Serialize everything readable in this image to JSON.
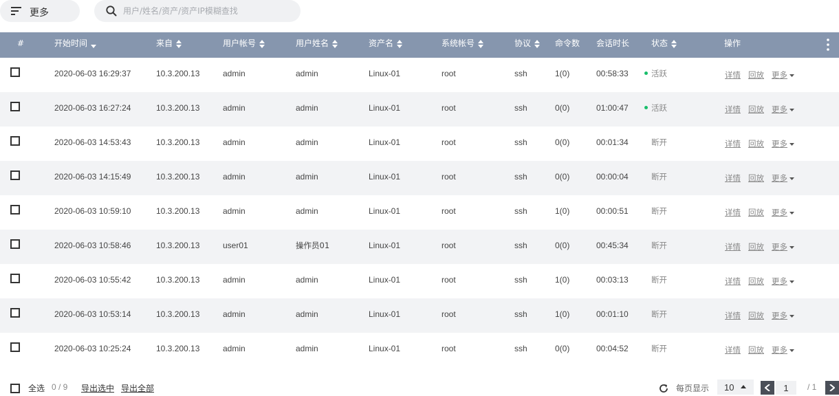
{
  "toolbar": {
    "more_label": "更多",
    "search_placeholder": "用户/姓名/资产/资产IP模糊查找"
  },
  "table": {
    "columns": {
      "index": "#",
      "start_time": "开始时间",
      "source": "来自",
      "user_account": "用户帐号",
      "user_name": "用户姓名",
      "asset_name": "资产名",
      "system_account": "系统帐号",
      "protocol": "协议",
      "command_count": "命令数",
      "duration": "会话时长",
      "status": "状态",
      "actions": "操作"
    },
    "action_labels": {
      "detail": "详情",
      "replay": "回放",
      "more": "更多"
    },
    "rows": [
      {
        "start_time": "2020-06-03 16:29:37",
        "source": "10.3.200.13",
        "user_account": "admin",
        "user_name": "admin",
        "asset_name": "Linux-01",
        "system_account": "root",
        "protocol": "ssh",
        "command_count": "1(0)",
        "duration": "00:58:33",
        "status": "活跃",
        "active": true
      },
      {
        "start_time": "2020-06-03 16:27:24",
        "source": "10.3.200.13",
        "user_account": "admin",
        "user_name": "admin",
        "asset_name": "Linux-01",
        "system_account": "root",
        "protocol": "ssh",
        "command_count": "0(0)",
        "duration": "01:00:47",
        "status": "活跃",
        "active": true
      },
      {
        "start_time": "2020-06-03 14:53:43",
        "source": "10.3.200.13",
        "user_account": "admin",
        "user_name": "admin",
        "asset_name": "Linux-01",
        "system_account": "root",
        "protocol": "ssh",
        "command_count": "0(0)",
        "duration": "00:01:34",
        "status": "断开",
        "active": false
      },
      {
        "start_time": "2020-06-03 14:15:49",
        "source": "10.3.200.13",
        "user_account": "admin",
        "user_name": "admin",
        "asset_name": "Linux-01",
        "system_account": "root",
        "protocol": "ssh",
        "command_count": "0(0)",
        "duration": "00:00:04",
        "status": "断开",
        "active": false
      },
      {
        "start_time": "2020-06-03 10:59:10",
        "source": "10.3.200.13",
        "user_account": "admin",
        "user_name": "admin",
        "asset_name": "Linux-01",
        "system_account": "root",
        "protocol": "ssh",
        "command_count": "1(0)",
        "duration": "00:00:51",
        "status": "断开",
        "active": false
      },
      {
        "start_time": "2020-06-03 10:58:46",
        "source": "10.3.200.13",
        "user_account": "user01",
        "user_name": "操作员01",
        "asset_name": "Linux-01",
        "system_account": "root",
        "protocol": "ssh",
        "command_count": "0(0)",
        "duration": "00:45:34",
        "status": "断开",
        "active": false
      },
      {
        "start_time": "2020-06-03 10:55:42",
        "source": "10.3.200.13",
        "user_account": "admin",
        "user_name": "admin",
        "asset_name": "Linux-01",
        "system_account": "root",
        "protocol": "ssh",
        "command_count": "1(0)",
        "duration": "00:03:13",
        "status": "断开",
        "active": false
      },
      {
        "start_time": "2020-06-03 10:53:14",
        "source": "10.3.200.13",
        "user_account": "admin",
        "user_name": "admin",
        "asset_name": "Linux-01",
        "system_account": "root",
        "protocol": "ssh",
        "command_count": "1(0)",
        "duration": "00:01:10",
        "status": "断开",
        "active": false
      },
      {
        "start_time": "2020-06-03 10:25:24",
        "source": "10.3.200.13",
        "user_account": "admin",
        "user_name": "admin",
        "asset_name": "Linux-01",
        "system_account": "root",
        "protocol": "ssh",
        "command_count": "0(0)",
        "duration": "00:04:52",
        "status": "断开",
        "active": false
      }
    ]
  },
  "footer": {
    "select_all_label": "全选",
    "selected_count": "0 / 9",
    "export_selected": "导出选中",
    "export_all": "导出全部",
    "per_page_label": "每页显示",
    "page_size": "10",
    "current_page": "1",
    "total_pages": "/ 1"
  },
  "colors": {
    "header_bg": "#8696ae",
    "row_alt_bg": "#f2f3f5",
    "active_dot": "#19be6b",
    "pager_btn": "#4a4f58"
  }
}
